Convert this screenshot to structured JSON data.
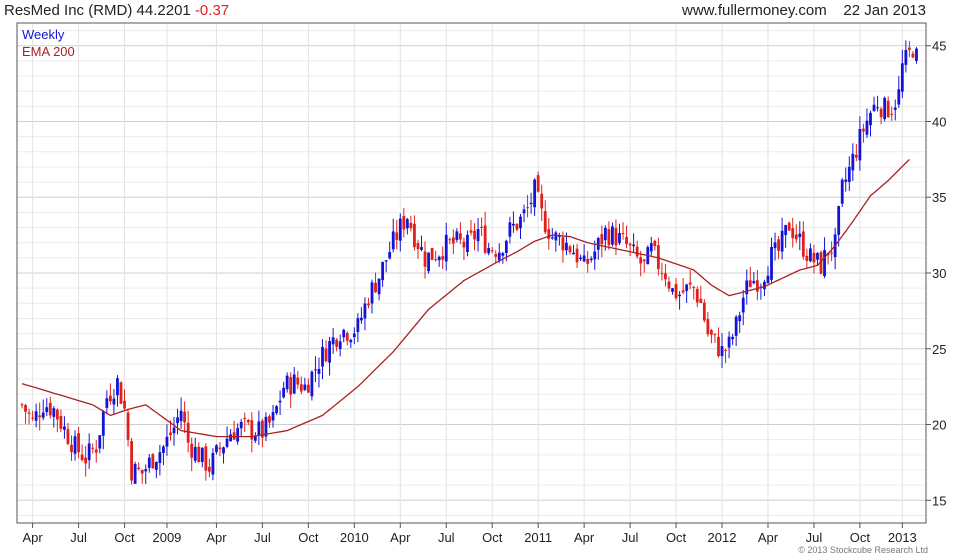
{
  "header": {
    "title": "ResMed Inc (RMD)",
    "price": "44.2201",
    "change": "-0.37",
    "site": "www.fullermoney.com",
    "date": "22 Jan 2013"
  },
  "copyright": "© 2013 Stockcube Research Ltd",
  "colors": {
    "up": "#1414d8",
    "down": "#e0201b",
    "ema": "#a82222",
    "grid": "#d9d9d9"
  },
  "chart_data": {
    "type": "candlestick",
    "legend": [
      "Weekly",
      "EMA 200"
    ],
    "legend_position": "top-left",
    "x_tick_labels": [
      "Apr",
      "Jul",
      "Oct",
      "2009",
      "Apr",
      "Jul",
      "Oct",
      "2010",
      "Apr",
      "Jul",
      "Oct",
      "2011",
      "Apr",
      "Jul",
      "Oct",
      "2012",
      "Apr",
      "Jul",
      "Oct",
      "2013"
    ],
    "x_tick_weeks": [
      3,
      16,
      29,
      41,
      55,
      68,
      81,
      94,
      107,
      120,
      133,
      146,
      159,
      172,
      185,
      198,
      211,
      224,
      237,
      249
    ],
    "y_ticks": [
      15,
      20,
      25,
      30,
      35,
      40,
      45
    ],
    "ylim": [
      13.5,
      46.5
    ],
    "axis_position": "right",
    "grid": true,
    "weeks_total": 255,
    "ema200_anchors": [
      [
        0,
        22.7
      ],
      [
        10,
        22.0
      ],
      [
        20,
        21.3
      ],
      [
        25,
        20.6
      ],
      [
        30,
        21.0
      ],
      [
        35,
        21.3
      ],
      [
        45,
        19.6
      ],
      [
        55,
        19.2
      ],
      [
        65,
        19.2
      ],
      [
        75,
        19.6
      ],
      [
        85,
        20.6
      ],
      [
        95,
        22.5
      ],
      [
        105,
        24.8
      ],
      [
        115,
        27.6
      ],
      [
        125,
        29.5
      ],
      [
        135,
        30.8
      ],
      [
        140,
        31.4
      ],
      [
        145,
        32.1
      ],
      [
        150,
        32.5
      ],
      [
        155,
        32.4
      ],
      [
        160,
        32.0
      ],
      [
        170,
        31.5
      ],
      [
        180,
        31.0
      ],
      [
        190,
        30.2
      ],
      [
        195,
        29.2
      ],
      [
        200,
        28.5
      ],
      [
        210,
        29.1
      ],
      [
        220,
        30.2
      ],
      [
        225,
        30.5
      ],
      [
        230,
        31.8
      ],
      [
        235,
        33.4
      ],
      [
        240,
        35.1
      ],
      [
        245,
        36.1
      ],
      [
        251,
        37.5
      ]
    ],
    "price_anchors": [
      [
        0,
        21.3
      ],
      [
        3,
        20.2
      ],
      [
        6,
        21.4
      ],
      [
        9,
        21.0
      ],
      [
        12,
        19.7
      ],
      [
        15,
        18.5
      ],
      [
        18,
        17.8
      ],
      [
        21,
        18.6
      ],
      [
        24,
        21.8
      ],
      [
        27,
        22.8
      ],
      [
        29,
        21.0
      ],
      [
        31,
        17.0
      ],
      [
        34,
        16.8
      ],
      [
        37,
        17.8
      ],
      [
        40,
        18.5
      ],
      [
        43,
        19.8
      ],
      [
        45,
        21.0
      ],
      [
        47,
        18.8
      ],
      [
        50,
        18.0
      ],
      [
        53,
        17.2
      ],
      [
        56,
        18.4
      ],
      [
        59,
        19.5
      ],
      [
        62,
        19.8
      ],
      [
        65,
        19.6
      ],
      [
        68,
        19.5
      ],
      [
        71,
        20.3
      ],
      [
        74,
        22.5
      ],
      [
        77,
        22.8
      ],
      [
        80,
        22.5
      ],
      [
        82,
        23.3
      ],
      [
        84,
        24.2
      ],
      [
        87,
        25.3
      ],
      [
        90,
        26.2
      ],
      [
        93,
        26.2
      ],
      [
        95,
        26.4
      ],
      [
        98,
        28.5
      ],
      [
        101,
        29.8
      ],
      [
        104,
        31.5
      ],
      [
        107,
        33.0
      ],
      [
        109,
        33.8
      ],
      [
        111,
        32.5
      ],
      [
        114,
        31.0
      ],
      [
        117,
        31.3
      ],
      [
        120,
        31.8
      ],
      [
        123,
        32.0
      ],
      [
        126,
        31.8
      ],
      [
        129,
        32.8
      ],
      [
        132,
        31.7
      ],
      [
        135,
        31.6
      ],
      [
        138,
        32.8
      ],
      [
        141,
        33.5
      ],
      [
        143,
        34.2
      ],
      [
        145,
        35.4
      ],
      [
        147,
        33.8
      ],
      [
        150,
        32.4
      ],
      [
        153,
        32.1
      ],
      [
        156,
        31.5
      ],
      [
        159,
        30.4
      ],
      [
        162,
        31.4
      ],
      [
        165,
        32.7
      ],
      [
        168,
        32.4
      ],
      [
        171,
        31.8
      ],
      [
        174,
        30.9
      ],
      [
        176,
        30.4
      ],
      [
        178,
        31.5
      ],
      [
        180,
        30.6
      ],
      [
        182,
        30.0
      ],
      [
        184,
        28.8
      ],
      [
        186,
        28.6
      ],
      [
        188,
        28.9
      ],
      [
        190,
        29.0
      ],
      [
        192,
        28.0
      ],
      [
        194,
        26.0
      ],
      [
        196,
        25.4
      ],
      [
        198,
        24.8
      ],
      [
        200,
        25.2
      ],
      [
        202,
        26.5
      ],
      [
        204,
        28.4
      ],
      [
        206,
        29.5
      ],
      [
        209,
        29.6
      ],
      [
        212,
        31.1
      ],
      [
        214,
        31.4
      ],
      [
        217,
        33.2
      ],
      [
        220,
        32.1
      ],
      [
        223,
        31.0
      ],
      [
        226,
        30.5
      ],
      [
        228,
        31.5
      ],
      [
        230,
        31.8
      ],
      [
        232,
        35.5
      ],
      [
        234,
        36.8
      ],
      [
        236,
        38.2
      ],
      [
        238,
        39.5
      ],
      [
        240,
        40.6
      ],
      [
        242,
        41.3
      ],
      [
        244,
        40.8
      ],
      [
        246,
        41.0
      ],
      [
        248,
        41.8
      ],
      [
        249,
        43.6
      ],
      [
        251,
        44.4
      ],
      [
        252,
        44.9
      ],
      [
        253,
        44.2
      ]
    ]
  }
}
